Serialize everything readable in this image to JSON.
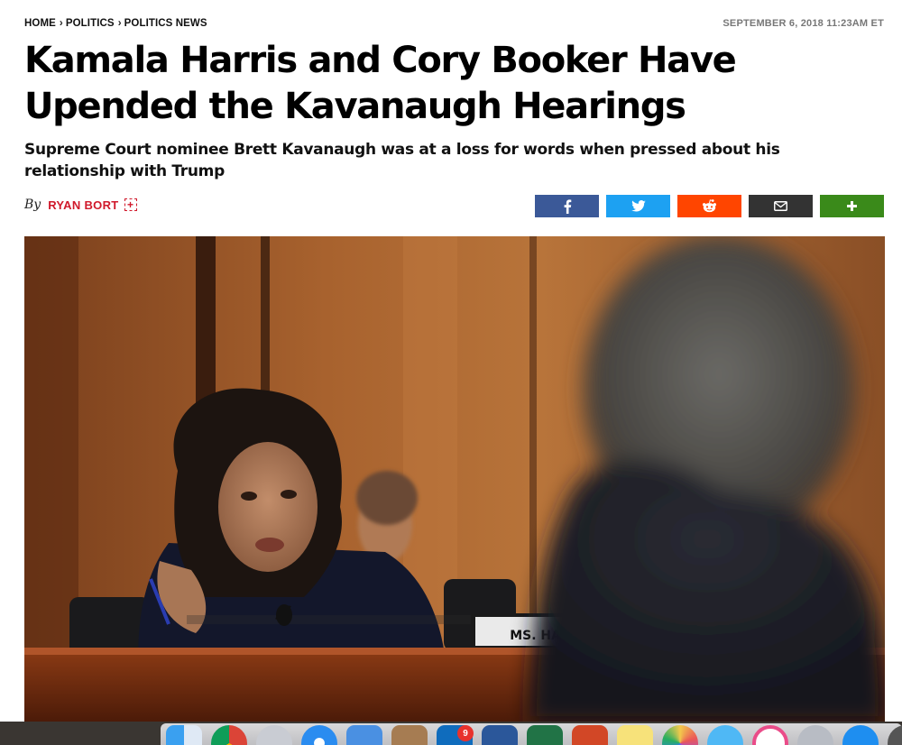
{
  "breadcrumb": {
    "items": [
      "HOME",
      "POLITICS",
      "POLITICS NEWS"
    ]
  },
  "dateline": "SEPTEMBER 6, 2018 11:23AM ET",
  "article": {
    "headline_line1": "Kamala Harris and Cory Booker Have",
    "headline_line2": "Upended the Kavanaugh Hearings",
    "subhead": "Supreme Court nominee Brett Kavanaugh was at a loss for words when pressed about his relationship with Trump",
    "byline_prefix": "By",
    "author": "RYAN BORT",
    "follow_glyph": "+"
  },
  "share": {
    "colors": {
      "facebook": "#3b5998",
      "twitter": "#1da1f2",
      "reddit": "#ff4500",
      "email": "#333333",
      "more": "#3a8a1a"
    }
  },
  "hero": {
    "nameplate": "MS. HAR"
  },
  "dock": {
    "mail_badge": "9",
    "icons": [
      "finder-icon",
      "chrome-icon",
      "launchpad-icon",
      "safari-icon",
      "mail-icon",
      "notes-icon",
      "outlook-icon",
      "word-icon",
      "excel-icon",
      "powerpoint-icon",
      "stickies-icon",
      "photos-icon",
      "messages-icon",
      "itunes-icon",
      "downloads-icon",
      "appstore-icon",
      "settings-icon"
    ]
  },
  "accent_color": "#d0192b"
}
